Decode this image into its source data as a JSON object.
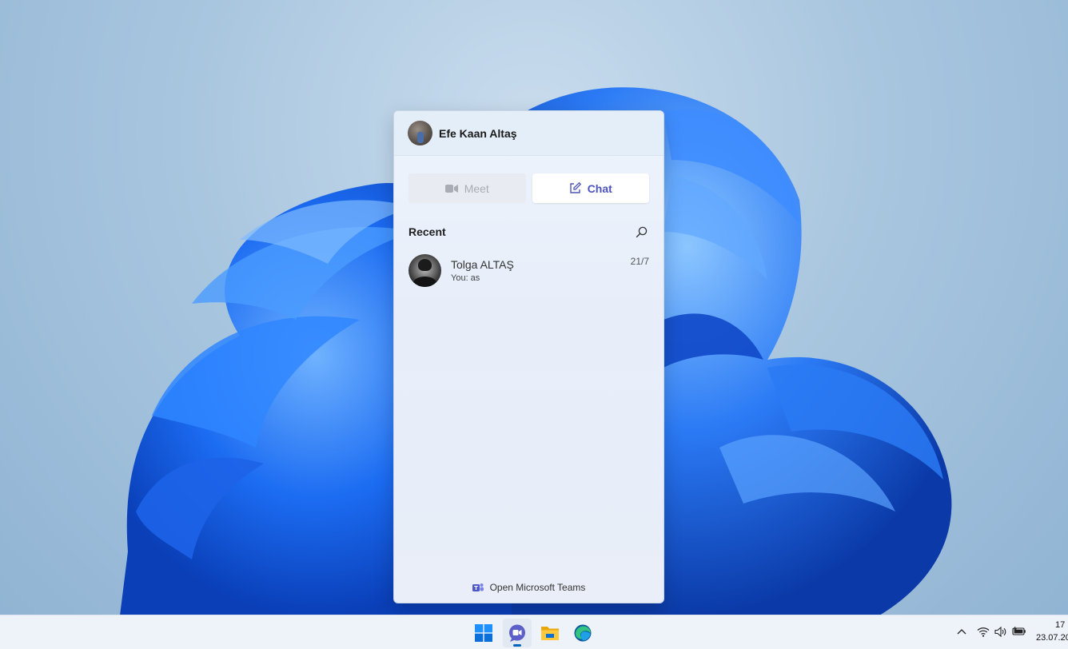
{
  "chat": {
    "user_name": "Efe Kaan Altaş",
    "meet_label": "Meet",
    "chat_label": "Chat",
    "recent_label": "Recent",
    "conversations": [
      {
        "name": "Tolga ALTAŞ",
        "preview": "You: as",
        "date": "21/7"
      }
    ],
    "footer_label": "Open Microsoft Teams"
  },
  "taskbar": {
    "apps": [
      "start-icon",
      "teams-chat-icon",
      "file-explorer-icon",
      "edge-icon"
    ],
    "active_app": "teams-chat-icon",
    "tray": [
      "chevron-up-icon",
      "wifi-icon",
      "volume-icon",
      "battery-icon"
    ],
    "time": "17",
    "date": "23.07.20"
  },
  "colors": {
    "accent": "#4b53bc",
    "taskbar_indicator": "#0067c0",
    "wallpaper_blue": "#1a5fe6"
  }
}
